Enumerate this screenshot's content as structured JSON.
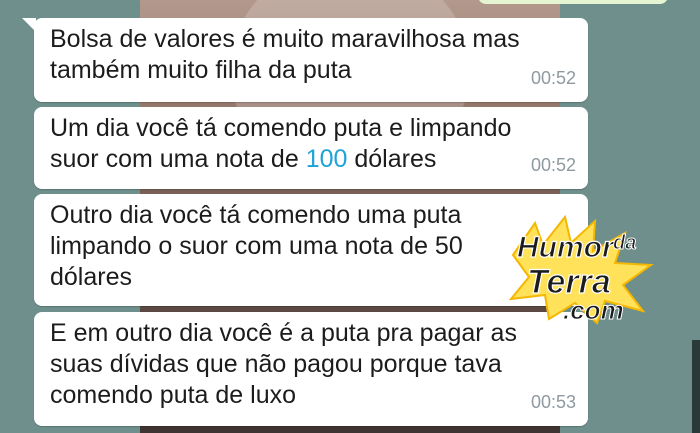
{
  "messages": [
    {
      "line1": "Bolsa de valores é muito maravilhosa mas",
      "line2": "também muito filha da puta",
      "time": "00:52"
    },
    {
      "line1": "Um dia você tá comendo puta e limpando",
      "line2_before": "suor com uma nota de ",
      "line2_highlight": "100",
      "line2_after": " dólares",
      "time": "00:52"
    },
    {
      "line1": "Outro dia você tá comendo uma puta",
      "line2": "limpando o suor com uma nota de 50",
      "line3": "dólares"
    },
    {
      "line1": "E em outro dia você é a puta pra pagar as",
      "line2": "suas dívidas que não pagou porque tava",
      "line3": "comendo puta de luxo",
      "time": "00:53"
    }
  ],
  "watermark": {
    "line1": "Humor",
    "da": "da",
    "line2": "Terra",
    "com": ".com"
  },
  "colors": {
    "background": "#6e8f8c",
    "bubble": "#ffffff",
    "link": "#1fa2d8",
    "timestamp": "#8e9aa0"
  }
}
